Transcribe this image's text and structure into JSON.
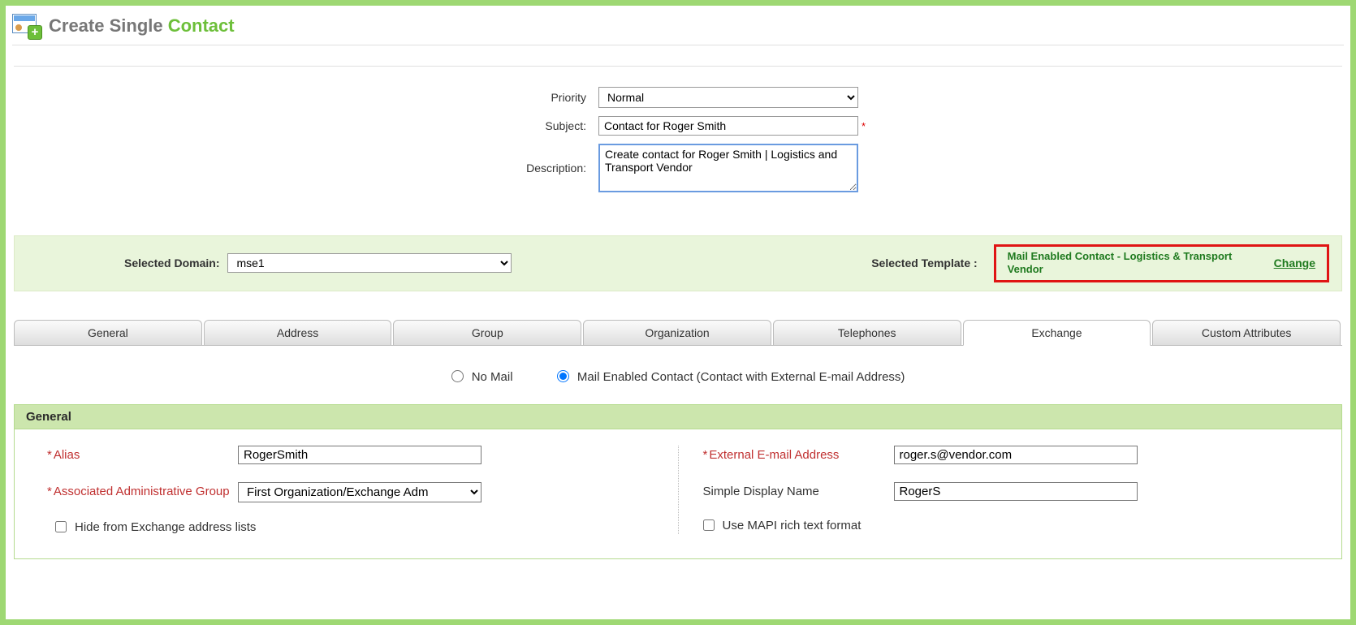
{
  "header": {
    "title_pre": "Create Single ",
    "title_accent": "Contact"
  },
  "form": {
    "priority_label": "Priority",
    "priority_value": "Normal",
    "subject_label": "Subject:",
    "subject_value": "Contact for Roger Smith",
    "description_label": "Description:",
    "description_value": "Create contact for Roger Smith | Logistics and Transport Vendor"
  },
  "bar": {
    "selected_domain_label": "Selected Domain:",
    "selected_domain_value": "mse1",
    "selected_template_label": "Selected Template :",
    "selected_template_value": "Mail Enabled Contact - Logistics & Transport Vendor",
    "change_label": "Change"
  },
  "tabs": {
    "general": "General",
    "address": "Address",
    "group": "Group",
    "organization": "Organization",
    "telephones": "Telephones",
    "exchange": "Exchange",
    "custom": "Custom Attributes"
  },
  "mailtype": {
    "nomail": "No Mail",
    "mailenabled": "Mail Enabled Contact (Contact with External E-mail Address)"
  },
  "section": {
    "title": "General",
    "alias_label": "Alias",
    "alias_value": "RogerSmith",
    "admin_group_label": "Associated Administrative Group",
    "admin_group_value": "First Organization/Exchange Adm",
    "hide_label": "Hide from Exchange address lists",
    "ext_email_label": "External E-mail Address",
    "ext_email_value": "roger.s@vendor.com",
    "simple_display_label": "Simple Display Name",
    "simple_display_value": "RogerS",
    "mapi_label": "Use MAPI rich text format"
  }
}
